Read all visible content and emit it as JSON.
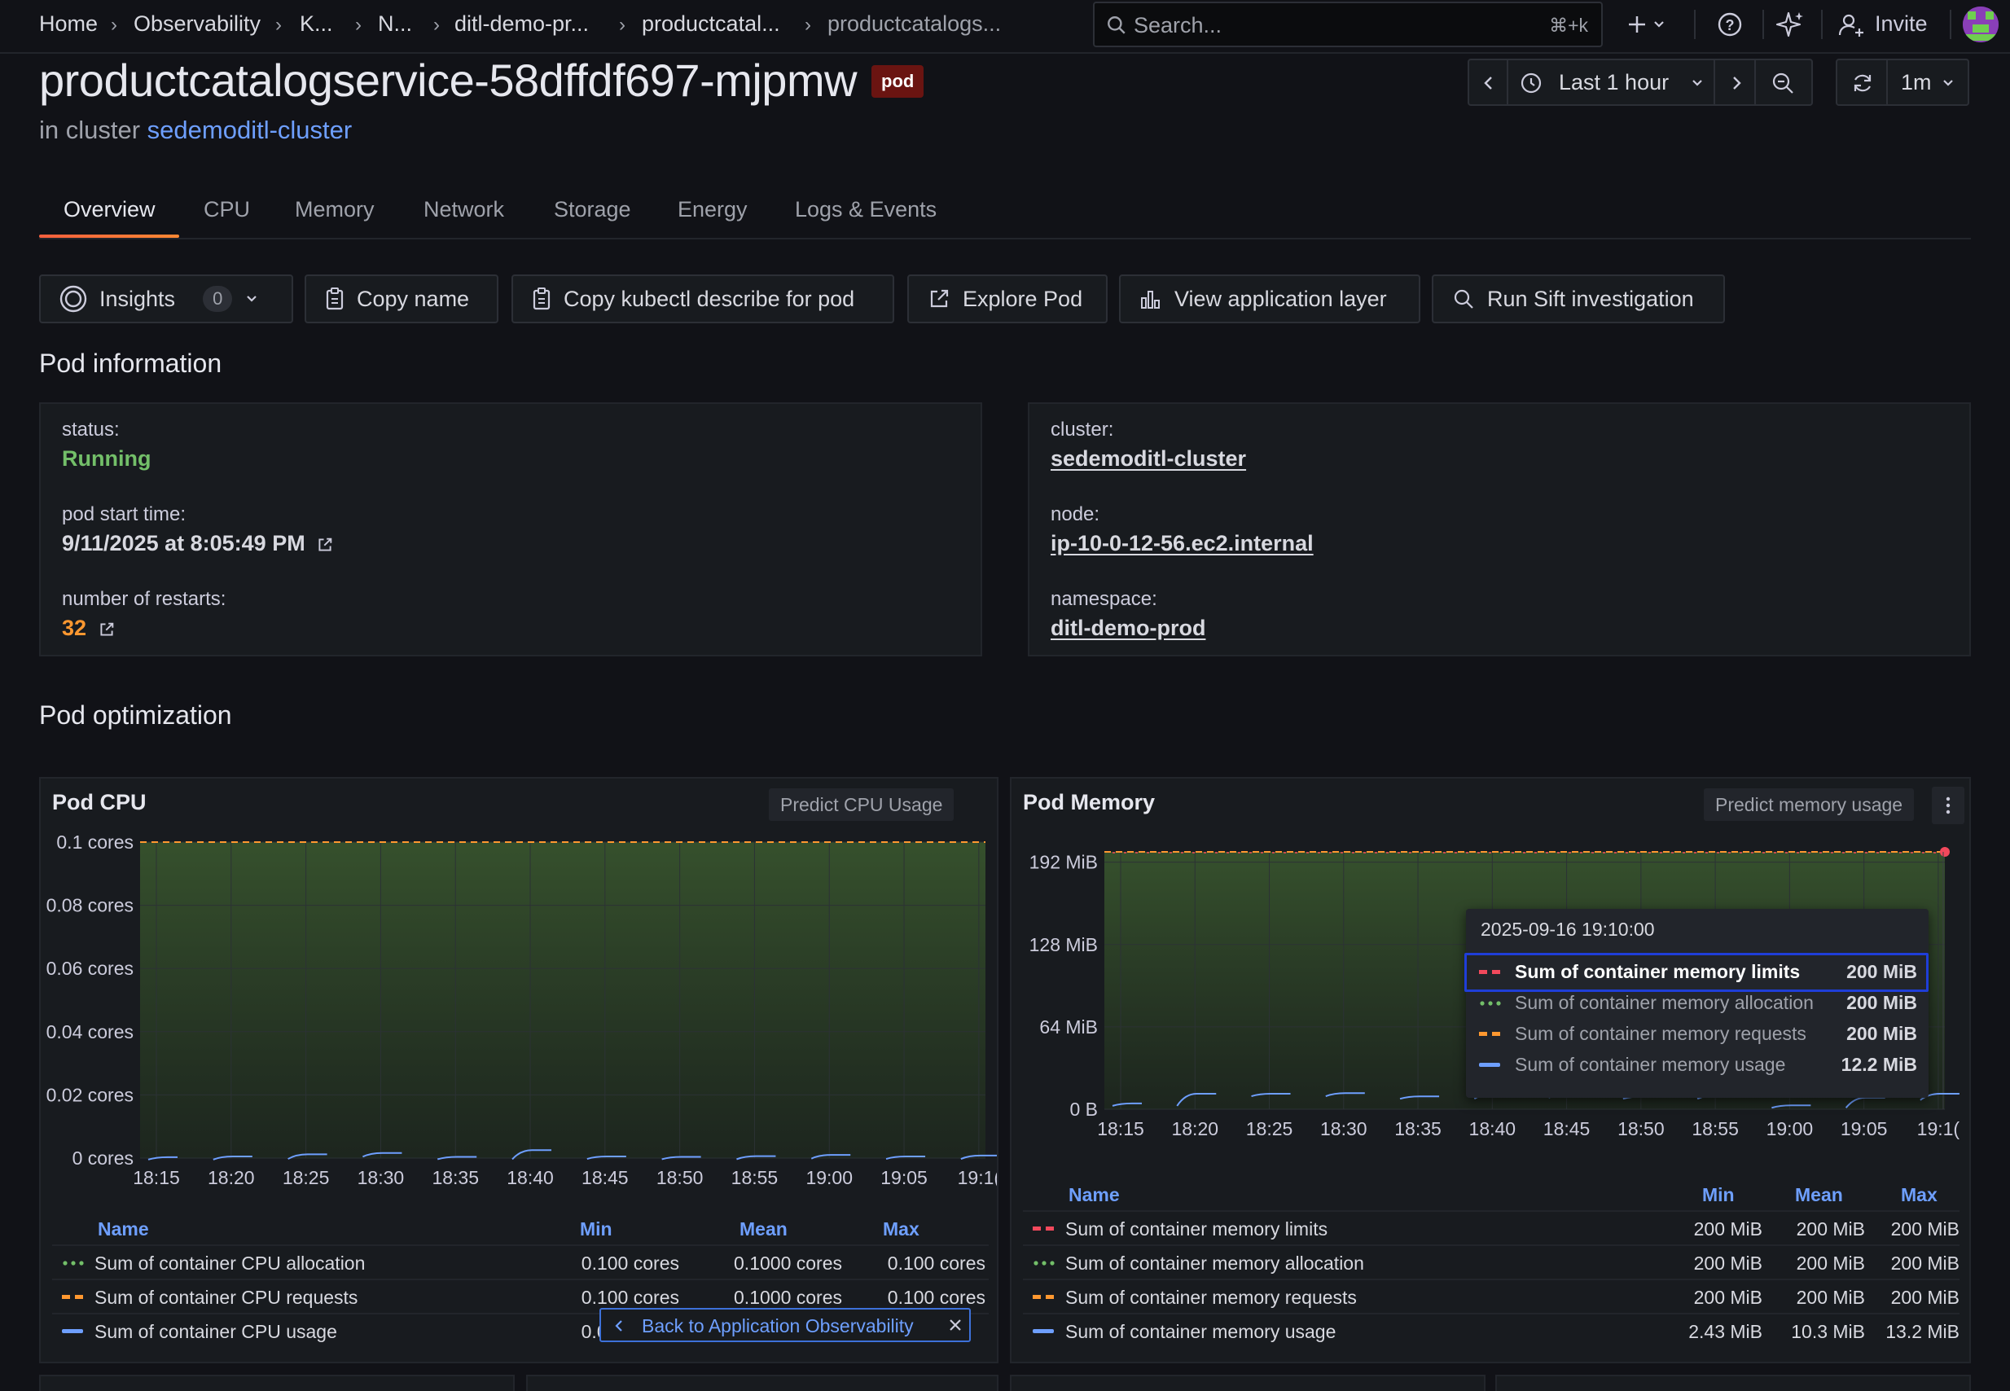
{
  "breadcrumbs": [
    "Home",
    "Observability",
    "K...",
    "N...",
    "ditl-demo-pr...",
    "productcatal...",
    "productcatalogs..."
  ],
  "search": {
    "placeholder": "Search...",
    "shortcut": "⌘+k"
  },
  "topbar": {
    "invite_label": "Invite"
  },
  "page": {
    "title": "productcatalogservice-58dffdf697-mjpmw",
    "badge": "pod",
    "subtitle_prefix": "in cluster",
    "cluster_link": "sedemoditl-cluster"
  },
  "time": {
    "range_label": "Last 1 hour",
    "refresh_label": "1m"
  },
  "tabs": [
    "Overview",
    "CPU",
    "Memory",
    "Network",
    "Storage",
    "Energy",
    "Logs & Events"
  ],
  "actions": {
    "insights_label": "Insights",
    "insights_count": "0",
    "copy_name": "Copy name",
    "copy_kubectl": "Copy kubectl describe for pod",
    "explore_pod": "Explore Pod",
    "view_app_layer": "View application layer",
    "run_sift": "Run Sift investigation"
  },
  "pod_info": {
    "heading": "Pod information",
    "status_label": "status:",
    "status_value": "Running",
    "start_label": "pod start time:",
    "start_value": "9/11/2025 at 8:05:49 PM",
    "restarts_label": "number of restarts:",
    "restarts_value": "32",
    "cluster_label": "cluster:",
    "cluster_value": "sedemoditl-cluster",
    "node_label": "node:",
    "node_value": "ip-10-0-12-56.ec2.internal",
    "namespace_label": "namespace:",
    "namespace_value": "ditl-demo-prod"
  },
  "optimization": {
    "heading": "Pod optimization"
  },
  "cpu_panel": {
    "title": "Pod CPU",
    "predict": "Predict CPU Usage",
    "legend_headers": {
      "name": "Name",
      "min": "Min",
      "mean": "Mean",
      "max": "Max"
    },
    "rows": [
      {
        "name": "Sum of container CPU allocation",
        "min": "0.100 cores",
        "mean": "0.1000 cores",
        "max": "0.100 cores",
        "color": "#73bf69",
        "style": "dotted"
      },
      {
        "name": "Sum of container CPU requests",
        "min": "0.100 cores",
        "mean": "0.1000 cores",
        "max": "0.100 cores",
        "color": "#ff9830",
        "style": "dashed"
      },
      {
        "name": "Sum of container CPU usage",
        "min": "0.0003",
        "mean": "",
        "max": "",
        "color": "#6e9fff",
        "style": "solid"
      }
    ]
  },
  "memory_panel": {
    "title": "Pod Memory",
    "predict": "Predict memory usage",
    "legend_headers": {
      "name": "Name",
      "min": "Min",
      "mean": "Mean",
      "max": "Max"
    },
    "rows": [
      {
        "name": "Sum of container memory limits",
        "min": "200 MiB",
        "mean": "200 MiB",
        "max": "200 MiB",
        "color": "#f2495c",
        "style": "dashed"
      },
      {
        "name": "Sum of container memory allocation",
        "min": "200 MiB",
        "mean": "200 MiB",
        "max": "200 MiB",
        "color": "#73bf69",
        "style": "dotted"
      },
      {
        "name": "Sum of container memory requests",
        "min": "200 MiB",
        "mean": "200 MiB",
        "max": "200 MiB",
        "color": "#ff9830",
        "style": "dashed"
      },
      {
        "name": "Sum of container memory usage",
        "min": "2.43 MiB",
        "mean": "10.3 MiB",
        "max": "13.2 MiB",
        "color": "#6e9fff",
        "style": "solid"
      }
    ],
    "tooltip": {
      "time": "2025-09-16 19:10:00",
      "rows": [
        {
          "name": "Sum of container memory limits",
          "value": "200 MiB"
        },
        {
          "name": "Sum of container memory allocation",
          "value": "200 MiB"
        },
        {
          "name": "Sum of container memory requests",
          "value": "200 MiB"
        },
        {
          "name": "Sum of container memory usage",
          "value": "12.2 MiB"
        }
      ]
    }
  },
  "back_banner": {
    "label": "Back to Application Observability"
  },
  "chart_data": [
    {
      "type": "line",
      "title": "Pod CPU",
      "x": [
        "18:15",
        "18:20",
        "18:25",
        "18:30",
        "18:35",
        "18:40",
        "18:45",
        "18:50",
        "18:55",
        "19:00",
        "19:05",
        "19:1("
      ],
      "yticks": [
        "0 cores",
        "0.02 cores",
        "0.04 cores",
        "0.06 cores",
        "0.08 cores",
        "0.1 cores"
      ],
      "ylim": [
        0,
        0.1
      ],
      "series": [
        {
          "name": "Sum of container CPU allocation",
          "values": [
            0.1,
            0.1,
            0.1,
            0.1,
            0.1,
            0.1,
            0.1,
            0.1,
            0.1,
            0.1,
            0.1,
            0.1
          ]
        },
        {
          "name": "Sum of container CPU requests",
          "values": [
            0.1,
            0.1,
            0.1,
            0.1,
            0.1,
            0.1,
            0.1,
            0.1,
            0.1,
            0.1,
            0.1,
            0.1
          ]
        },
        {
          "name": "Sum of container CPU usage",
          "values": [
            0.0003,
            0.0005,
            0.0012,
            0.0016,
            0.0004,
            0.0025,
            0.0005,
            0.0004,
            0.0006,
            0.001,
            0.0005,
            0.0008
          ]
        }
      ]
    },
    {
      "type": "line",
      "title": "Pod Memory",
      "x": [
        "18:15",
        "18:20",
        "18:25",
        "18:30",
        "18:35",
        "18:40",
        "18:45",
        "18:50",
        "18:55",
        "19:00",
        "19:05",
        "19:1("
      ],
      "yticks": [
        "0 B",
        "64 MiB",
        "128 MiB",
        "192 MiB"
      ],
      "ylim": [
        0,
        200
      ],
      "series": [
        {
          "name": "Sum of container memory limits",
          "values": [
            200,
            200,
            200,
            200,
            200,
            200,
            200,
            200,
            200,
            200,
            200,
            200
          ]
        },
        {
          "name": "Sum of container memory allocation",
          "values": [
            200,
            200,
            200,
            200,
            200,
            200,
            200,
            200,
            200,
            200,
            200,
            200
          ]
        },
        {
          "name": "Sum of container memory requests",
          "values": [
            200,
            200,
            200,
            200,
            200,
            200,
            200,
            200,
            200,
            200,
            200,
            200
          ]
        },
        {
          "name": "Sum of container memory usage",
          "values": [
            4.5,
            12,
            12,
            12.5,
            10,
            12,
            11,
            10,
            11,
            3,
            9,
            12
          ]
        }
      ]
    }
  ]
}
